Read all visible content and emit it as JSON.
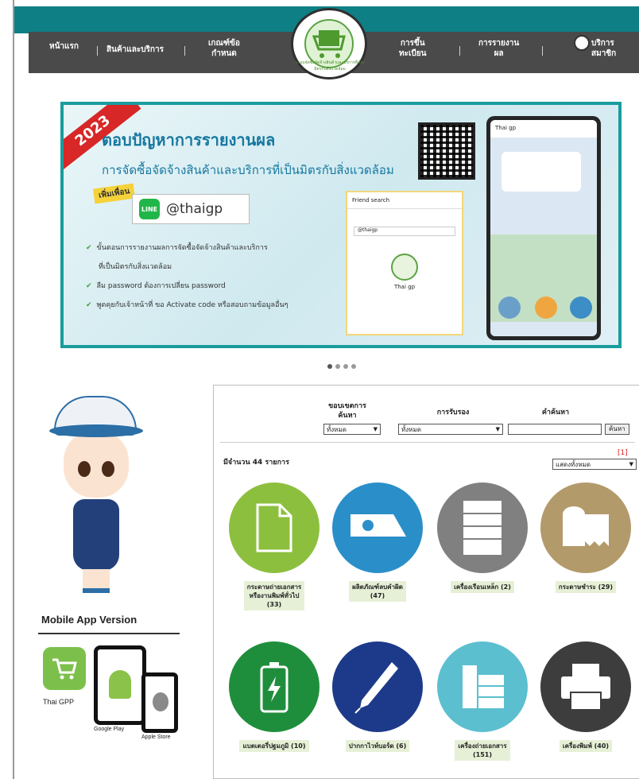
{
  "nav": {
    "items": [
      "หน้าแรก",
      "สินค้าและบริการ",
      "เกณฑ์ข้อ\nกำหนด",
      "การขึ้น\nทะเบียน",
      "การรายงาน\nผล",
      "บริการ\nสมาชิก"
    ],
    "logo_text": "ระบบจัดซื้อจัดจ้างสินค้าและบริการที่เป็นมิตรกับสิ่งแวดล้อม"
  },
  "banner": {
    "year": "2023",
    "title": "ตอบปัญหาการรายงานผล",
    "subtitle": "การจัดซื้อจัดจ้างสินค้าและบริการที่เป็นมิตรกับสิ่งแวดล้อม",
    "add_friend": "เพิ่มเพื่อน",
    "line_icon": "LINE",
    "line_id": "@thaigp",
    "bullets": [
      "ขั้นตอนการรายงานผลการจัดซื้อจัดจ้างสินค้าและบริการ",
      "ที่เป็นมิตรกับสิ่งแวดล้อม",
      "ลืม password ต้องการเปลี่ยน password",
      "พูดคุยกับเจ้าหน้าที่ ขอ Activate code หรือสอบถามข้อมูลอื่นๆ"
    ],
    "phone_friend_search": "Friend search",
    "phone_search_value": "@thaigp",
    "phone_account_name": "Thai gp",
    "phone_chat_title": "Thai gp"
  },
  "mobile": {
    "title": "Mobile App Version",
    "app_name": "Thai GPP",
    "google_play": "Google Play",
    "apple_store": "Apple Store"
  },
  "filters": {
    "scope_label": "ขอบเขตการ\nค้นหา",
    "scope_value": "ทั้งหมด",
    "cert_label": "การรับรอง",
    "cert_value": "ทั้งหมด",
    "keyword_label": "คำค้นหา",
    "keyword_value": "",
    "search_button": "ค้นหา",
    "count_text": "มีจำนวน 44 รายการ",
    "page_indicator": "[1]",
    "show_value": "แสดงทั้งหมด"
  },
  "categories": [
    {
      "label": "กระดาษถ่ายเอกสาร\nหรืองานพิมพ์ทั่วไป\n(33)",
      "color": "#8dbf3f",
      "icon": "document-icon"
    },
    {
      "label": "ผลิตภัณฑ์ลบคำผิด\n(47)",
      "color": "#2a8fc9",
      "icon": "correction-tape-icon"
    },
    {
      "label": "เครื่องเรือนเหล็ก (2)",
      "color": "#808080",
      "icon": "steel-cabinet-icon"
    },
    {
      "label": "กระดาษชำระ (29)",
      "color": "#b39a6a",
      "icon": "tissue-roll-icon"
    },
    {
      "label": "แบตเตอรี่ปฐมภูมิ (10)",
      "color": "#1f8e3c",
      "icon": "battery-icon"
    },
    {
      "label": "ปากกาไวท์บอร์ด (6)",
      "color": "#1d3a8a",
      "icon": "pen-icon"
    },
    {
      "label": "เครื่องถ่ายเอกสาร\n(151)",
      "color": "#5cbfd0",
      "icon": "copier-icon"
    },
    {
      "label": "เครื่องพิมพ์ (40)",
      "color": "#3d3d3d",
      "icon": "printer-icon"
    }
  ]
}
